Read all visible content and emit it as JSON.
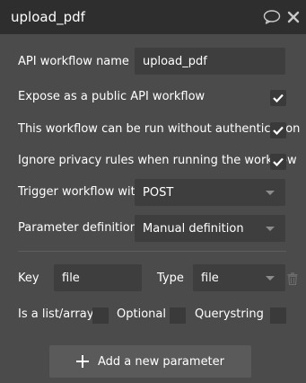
{
  "window": {
    "title": "upload_pdf"
  },
  "form": {
    "workflow_name_label": "API workflow name",
    "workflow_name_value": "upload_pdf",
    "expose_label": "Expose as a public API workflow",
    "expose_checked": true,
    "no_auth_label": "This workflow can be run without authentication",
    "no_auth_checked": true,
    "ignore_privacy_label": "Ignore privacy rules when running the workflow",
    "ignore_privacy_checked": true,
    "trigger_label": "Trigger workflow with",
    "trigger_value": "POST",
    "param_def_label": "Parameter definition",
    "param_def_value": "Manual definition"
  },
  "parameter": {
    "key_label": "Key",
    "key_value": "file",
    "type_label": "Type",
    "type_value": "file",
    "is_list_label": "Is a list/array",
    "optional_label": "Optional",
    "querystring_label": "Querystring"
  },
  "actions": {
    "add_parameter_label": "Add a new parameter"
  },
  "icons": {
    "comment": "comment-icon",
    "close": "close-icon",
    "check": "checkmark-icon",
    "dropdown": "chevron-down-icon",
    "trash": "trash-icon",
    "plus": "plus-icon"
  },
  "colors": {
    "panel_bg": "#4b4b4b",
    "titlebar_bg": "#2e2e2e",
    "field_bg": "#3e3e3e",
    "text": "#ffffff"
  }
}
